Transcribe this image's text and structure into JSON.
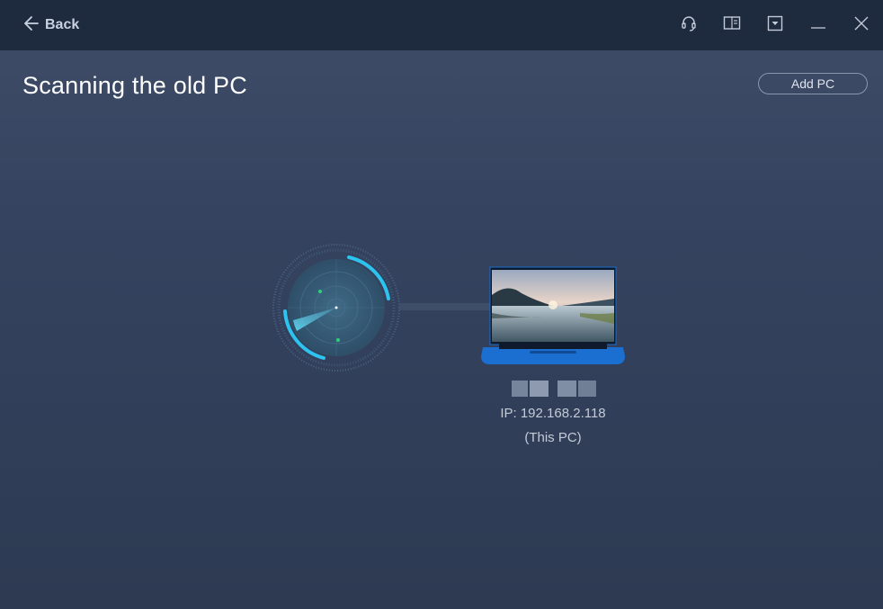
{
  "titlebar": {
    "back_label": "Back",
    "icons": [
      "headset-icon",
      "book-icon",
      "minimize-to-tray-icon",
      "minimize-icon",
      "close-icon"
    ]
  },
  "page": {
    "title": "Scanning the old PC",
    "add_pc_label": "Add PC"
  },
  "scanner": {
    "progress": 0.4,
    "accent": "#2cc3ee",
    "blip_color": "#2bd07a"
  },
  "device": {
    "name_blurred": true,
    "ip": "IP: 192.168.2.118",
    "tag": "(This PC)",
    "laptop_color": "#1a6fd0"
  },
  "colors": {
    "titlebar_bg": "#1e2a3e",
    "body_bg": "#36445f",
    "text_muted": "#c4cbd8"
  }
}
